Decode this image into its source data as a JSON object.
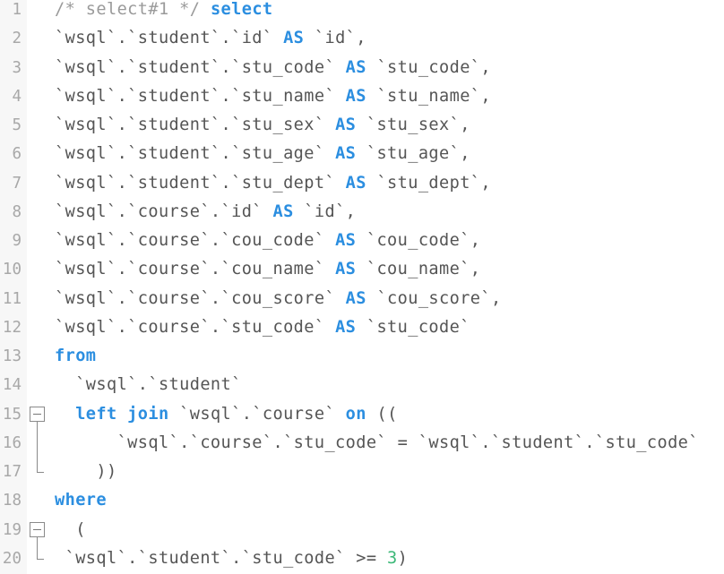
{
  "editor": {
    "lines": [
      {
        "no": "1",
        "fold": "",
        "tokens": [
          {
            "t": "/* select#1 */",
            "c": "cm"
          },
          {
            "t": " ",
            "c": ""
          },
          {
            "t": "select",
            "c": "kw"
          }
        ]
      },
      {
        "no": "2",
        "fold": "",
        "tokens": [
          {
            "t": "`wsql`.`student`.`id` ",
            "c": ""
          },
          {
            "t": "AS",
            "c": "kw"
          },
          {
            "t": " `id`,",
            "c": ""
          }
        ]
      },
      {
        "no": "3",
        "fold": "",
        "tokens": [
          {
            "t": "`wsql`.`student`.`stu_code` ",
            "c": ""
          },
          {
            "t": "AS",
            "c": "kw"
          },
          {
            "t": " `stu_code`,",
            "c": ""
          }
        ]
      },
      {
        "no": "4",
        "fold": "",
        "tokens": [
          {
            "t": "`wsql`.`student`.`stu_name` ",
            "c": ""
          },
          {
            "t": "AS",
            "c": "kw"
          },
          {
            "t": " `stu_name`,",
            "c": ""
          }
        ]
      },
      {
        "no": "5",
        "fold": "",
        "tokens": [
          {
            "t": "`wsql`.`student`.`stu_sex` ",
            "c": ""
          },
          {
            "t": "AS",
            "c": "kw"
          },
          {
            "t": " `stu_sex`,",
            "c": ""
          }
        ]
      },
      {
        "no": "6",
        "fold": "",
        "tokens": [
          {
            "t": "`wsql`.`student`.`stu_age` ",
            "c": ""
          },
          {
            "t": "AS",
            "c": "kw"
          },
          {
            "t": " `stu_age`,",
            "c": ""
          }
        ]
      },
      {
        "no": "7",
        "fold": "",
        "tokens": [
          {
            "t": "`wsql`.`student`.`stu_dept` ",
            "c": ""
          },
          {
            "t": "AS",
            "c": "kw"
          },
          {
            "t": " `stu_dept`,",
            "c": ""
          }
        ]
      },
      {
        "no": "8",
        "fold": "",
        "tokens": [
          {
            "t": "`wsql`.`course`.`id` ",
            "c": ""
          },
          {
            "t": "AS",
            "c": "kw"
          },
          {
            "t": " `id`,",
            "c": ""
          }
        ]
      },
      {
        "no": "9",
        "fold": "",
        "tokens": [
          {
            "t": "`wsql`.`course`.`cou_code` ",
            "c": ""
          },
          {
            "t": "AS",
            "c": "kw"
          },
          {
            "t": " `cou_code`,",
            "c": ""
          }
        ]
      },
      {
        "no": "10",
        "fold": "",
        "tokens": [
          {
            "t": "`wsql`.`course`.`cou_name` ",
            "c": ""
          },
          {
            "t": "AS",
            "c": "kw"
          },
          {
            "t": " `cou_name`,",
            "c": ""
          }
        ]
      },
      {
        "no": "11",
        "fold": "",
        "tokens": [
          {
            "t": "`wsql`.`course`.`cou_score` ",
            "c": ""
          },
          {
            "t": "AS",
            "c": "kw"
          },
          {
            "t": " `cou_score`,",
            "c": ""
          }
        ]
      },
      {
        "no": "12",
        "fold": "",
        "tokens": [
          {
            "t": "`wsql`.`course`.`stu_code` ",
            "c": ""
          },
          {
            "t": "AS",
            "c": "kw"
          },
          {
            "t": " `stu_code`",
            "c": ""
          }
        ]
      },
      {
        "no": "13",
        "fold": "",
        "tokens": [
          {
            "t": "from",
            "c": "kw"
          }
        ]
      },
      {
        "no": "14",
        "fold": "",
        "tokens": [
          {
            "t": "  `wsql`.`student`",
            "c": ""
          }
        ]
      },
      {
        "no": "15",
        "fold": "open",
        "tokens": [
          {
            "t": "  ",
            "c": ""
          },
          {
            "t": "left join",
            "c": "kw"
          },
          {
            "t": " `wsql`.`course` ",
            "c": ""
          },
          {
            "t": "on",
            "c": "kw"
          },
          {
            "t": " ((",
            "c": ""
          }
        ]
      },
      {
        "no": "16",
        "fold": "mid",
        "tokens": [
          {
            "t": "      `wsql`.`course`.`stu_code` = `wsql`.`student`.`stu_code`",
            "c": ""
          }
        ]
      },
      {
        "no": "17",
        "fold": "end",
        "tokens": [
          {
            "t": "    ))",
            "c": ""
          }
        ]
      },
      {
        "no": "18",
        "fold": "",
        "tokens": [
          {
            "t": "where",
            "c": "kw"
          }
        ]
      },
      {
        "no": "19",
        "fold": "open",
        "tokens": [
          {
            "t": "  (",
            "c": ""
          }
        ]
      },
      {
        "no": "20",
        "fold": "end",
        "tokens": [
          {
            "t": " `wsql`.`student`.`stu_code` >= ",
            "c": ""
          },
          {
            "t": "3",
            "c": "num"
          },
          {
            "t": ")",
            "c": ""
          }
        ]
      }
    ]
  }
}
